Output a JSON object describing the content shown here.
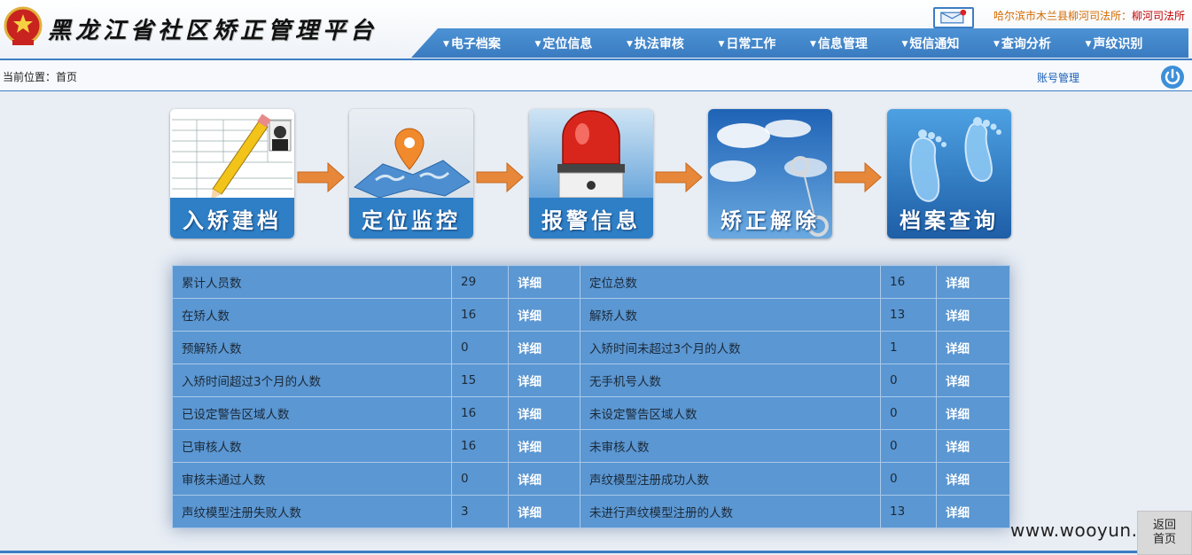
{
  "header": {
    "title": "黑龙江省社区矫正管理平台",
    "org_prefix": "哈尔滨市木兰县柳河司法所：",
    "org_short": "柳河司法所"
  },
  "nav": {
    "items": [
      {
        "label": "电子档案"
      },
      {
        "label": "定位信息"
      },
      {
        "label": "执法审核"
      },
      {
        "label": "日常工作"
      },
      {
        "label": "信息管理"
      },
      {
        "label": "短信通知"
      },
      {
        "label": "查询分析"
      },
      {
        "label": "声纹识别"
      }
    ]
  },
  "location": {
    "breadcrumb": "当前位置：首页",
    "account_link": "账号管理"
  },
  "workflow": {
    "tiles": [
      {
        "label": "入矫建档",
        "icon": "pencil-form-icon"
      },
      {
        "label": "定位监控",
        "icon": "map-pin-icon"
      },
      {
        "label": "报警信息",
        "icon": "alarm-light-icon"
      },
      {
        "label": "矫正解除",
        "icon": "handcuffs-sky-icon"
      },
      {
        "label": "档案查询",
        "icon": "footprints-icon"
      }
    ]
  },
  "stats": {
    "detail_label": "详细",
    "rows": [
      {
        "l_label": "累计人员数",
        "l_value": "29",
        "r_label": "定位总数",
        "r_value": "16"
      },
      {
        "l_label": "在矫人数",
        "l_value": "16",
        "r_label": "解矫人数",
        "r_value": "13"
      },
      {
        "l_label": "预解矫人数",
        "l_value": "0",
        "r_label": "入矫时间未超过3个月的人数",
        "r_value": "1"
      },
      {
        "l_label": "入矫时间超过3个月的人数",
        "l_value": "15",
        "r_label": "无手机号人数",
        "r_value": "0"
      },
      {
        "l_label": "已设定警告区域人数",
        "l_value": "16",
        "r_label": "未设定警告区域人数",
        "r_value": "0"
      },
      {
        "l_label": "已审核人数",
        "l_value": "16",
        "r_label": "未审核人数",
        "r_value": "0"
      },
      {
        "l_label": "审核未通过人数",
        "l_value": "0",
        "r_label": "声纹模型注册成功人数",
        "r_value": "0"
      },
      {
        "l_label": "声纹模型注册失败人数",
        "l_value": "3",
        "r_label": "未进行声纹模型注册的人数",
        "r_value": "13"
      }
    ]
  },
  "footer": {
    "to_top_line1": "返回",
    "to_top_line2": "首页",
    "watermark": "www.wooyun.org"
  },
  "colors": {
    "primary_blue": "#3d7dc3",
    "table_blue": "#5b97d2",
    "org_orange": "#d36b00"
  }
}
